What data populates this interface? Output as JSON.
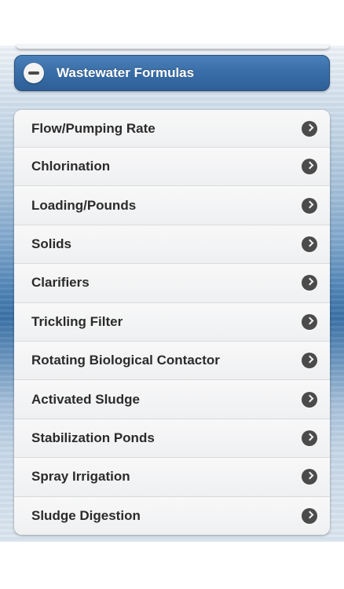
{
  "header": {
    "title": "Wastewater Formulas",
    "icon": "minus-circle-icon",
    "accent_color": "#3a6ea8"
  },
  "menu": {
    "item_icon": "chevron-right-circle-icon",
    "items": [
      {
        "label": "Flow/Pumping Rate"
      },
      {
        "label": "Chlorination"
      },
      {
        "label": "Loading/Pounds"
      },
      {
        "label": "Solids"
      },
      {
        "label": "Clarifiers"
      },
      {
        "label": "Trickling Filter"
      },
      {
        "label": "Rotating Biological Contactor"
      },
      {
        "label": "Activated Sludge"
      },
      {
        "label": "Stabilization Ponds"
      },
      {
        "label": "Spray Irrigation"
      },
      {
        "label": "Sludge Digestion"
      }
    ]
  }
}
